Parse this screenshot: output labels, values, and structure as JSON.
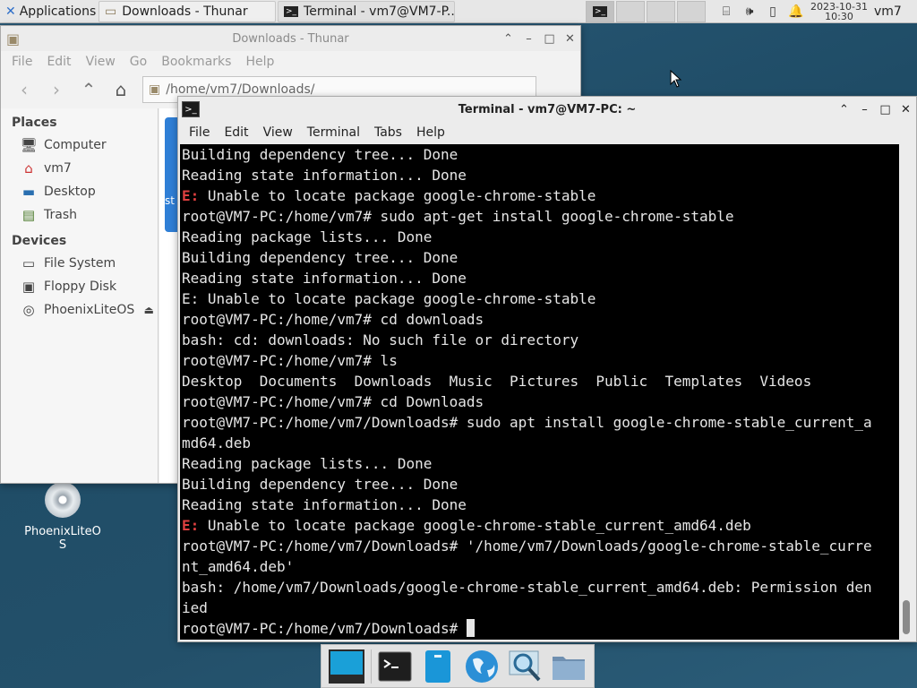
{
  "panel": {
    "apps_label": "Applications",
    "tasks": [
      {
        "label": "Downloads - Thunar",
        "icon": "folder-icon"
      },
      {
        "label": "Terminal - vm7@VM7-P...",
        "icon": "terminal-icon"
      }
    ],
    "clock_date": "2023-10-31",
    "clock_time": "10:30",
    "user": "vm7"
  },
  "thunar": {
    "title": "Downloads - Thunar",
    "menu": [
      "File",
      "Edit",
      "View",
      "Go",
      "Bookmarks",
      "Help"
    ],
    "location": "/home/vm7/Downloads/",
    "places_header": "Places",
    "places": [
      "Computer",
      "vm7",
      "Desktop",
      "Trash"
    ],
    "devices_header": "Devices",
    "devices": [
      "File System",
      "Floppy Disk",
      "PhoenixLiteOS"
    ],
    "folder_partial_label": "st"
  },
  "terminal": {
    "title": "Terminal - vm7@VM7-PC: ~",
    "menu": [
      "File",
      "Edit",
      "View",
      "Terminal",
      "Tabs",
      "Help"
    ],
    "lines": [
      "Building dependency tree... Done",
      "Reading state information... Done",
      "E: Unable to locate package google-chrome-stable",
      "root@VM7-PC:/home/vm7# sudo apt-get install google-chrome-stable",
      "Reading package lists... Done",
      "Building dependency tree... Done",
      "Reading state information... Done",
      "E: Unable to locate package google-chrome-stable",
      "root@VM7-PC:/home/vm7# cd downloads",
      "bash: cd: downloads: No such file or directory",
      "root@VM7-PC:/home/vm7# ls",
      "Desktop  Documents  Downloads  Music  Pictures  Public  Templates  Videos",
      "root@VM7-PC:/home/vm7# cd Downloads",
      "root@VM7-PC:/home/vm7/Downloads# sudo apt install google-chrome-stable_current_a",
      "md64.deb",
      "Reading package lists... Done",
      "Building dependency tree... Done",
      "Reading state information... Done",
      "E: Unable to locate package google-chrome-stable_current_amd64.deb",
      "root@VM7-PC:/home/vm7/Downloads# '/home/vm7/Downloads/google-chrome-stable_curre",
      "nt_amd64.deb'",
      "bash: /home/vm7/Downloads/google-chrome-stable_current_amd64.deb: Permission den",
      "ied",
      "root@VM7-PC:/home/vm7/Downloads# "
    ],
    "error_prefix": "E:"
  },
  "desktop": {
    "icon_label": "PhoenixLiteOS"
  },
  "dock": [
    "show-desktop-icon",
    "terminal-icon",
    "file-manager-icon",
    "web-browser-icon",
    "app-finder-icon",
    "folder-icon"
  ]
}
